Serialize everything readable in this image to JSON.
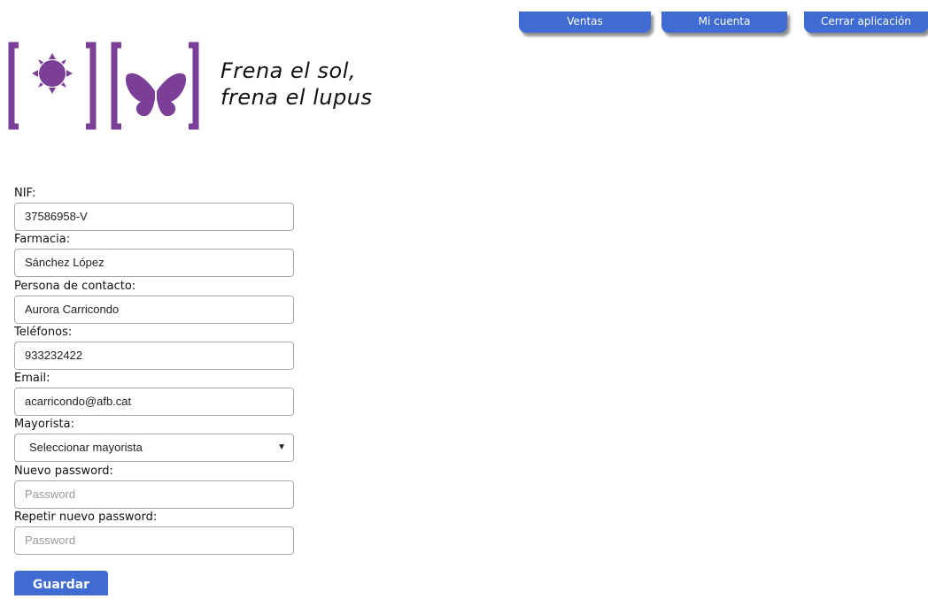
{
  "nav": {
    "ventas": "Ventas",
    "mi_cuenta": "Mi cuenta",
    "cerrar": "Cerrar aplicación"
  },
  "logo": {
    "line1": "Frena el sol,",
    "line2": "frena el lupus",
    "icons": [
      "sun-icon",
      "butterfly-icon"
    ]
  },
  "form": {
    "nif_label": "NIF:",
    "nif_value": "37586958-V",
    "farmacia_label": "Farmacia:",
    "farmacia_value": "Sánchez López",
    "contacto_label": "Persona de contacto:",
    "contacto_value": "Aurora Carricondo",
    "telefonos_label": "Teléfonos:",
    "telefonos_value": "933232422",
    "email_label": "Email:",
    "email_value": "acarricondo@afb.cat",
    "mayorista_label": "Mayorista:",
    "mayorista_value": "Seleccionar mayorista",
    "password_label": "Nuevo password:",
    "password_placeholder": "Password",
    "repeat_label": "Repetir nuevo password:",
    "repeat_placeholder": "Password",
    "save_label": "Guardar"
  },
  "colors": {
    "accent": "#3f6bd3",
    "brand_purple": "#7b3f98"
  }
}
